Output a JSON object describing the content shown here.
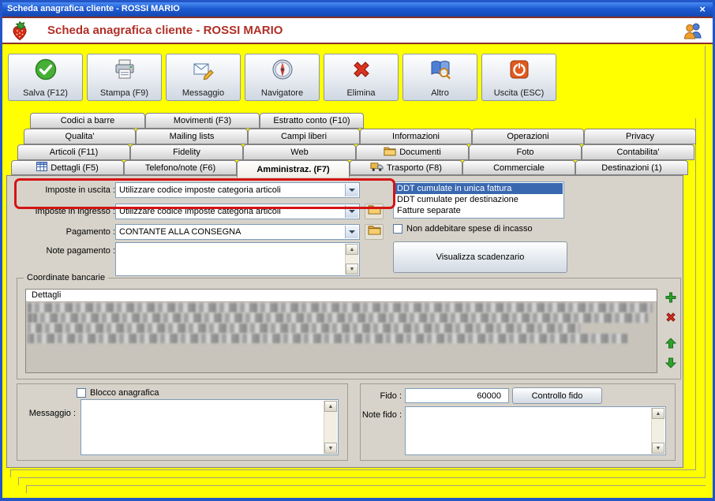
{
  "window": {
    "title": "Scheda anagrafica cliente - ROSSI MARIO",
    "close_glyph": "×"
  },
  "header": {
    "title": "Scheda anagrafica cliente - ROSSI MARIO"
  },
  "toolbar": {
    "buttons": [
      {
        "label": "Salva (F12)",
        "icon": "save-check-icon"
      },
      {
        "label": "Stampa (F9)",
        "icon": "printer-icon"
      },
      {
        "label": "Messaggio",
        "icon": "message-icon"
      },
      {
        "label": "Navigatore",
        "icon": "compass-icon"
      },
      {
        "label": "Elimina",
        "icon": "delete-x-icon"
      },
      {
        "label": "Altro",
        "icon": "book-search-icon"
      },
      {
        "label": "Uscita (ESC)",
        "icon": "power-icon"
      }
    ]
  },
  "tabs": {
    "rows": [
      [
        {
          "label": "Codici a barre"
        },
        {
          "label": "Movimenti (F3)"
        },
        {
          "label": "Estratto conto (F10)"
        }
      ],
      [
        {
          "label": "Qualita'"
        },
        {
          "label": "Mailing lists"
        },
        {
          "label": "Campi liberi"
        },
        {
          "label": "Informazioni"
        },
        {
          "label": "Operazioni"
        },
        {
          "label": "Privacy"
        }
      ],
      [
        {
          "label": "Articoli (F11)"
        },
        {
          "label": "Fidelity"
        },
        {
          "label": "Web"
        },
        {
          "label": "Documenti",
          "icon": "folder"
        },
        {
          "label": "Foto"
        },
        {
          "label": "Contabilita'"
        }
      ],
      [
        {
          "label": "Dettagli (F5)",
          "icon": "grid"
        },
        {
          "label": "Telefono/note (F6)"
        },
        {
          "label": "Amministraz. (F7)",
          "active": true
        },
        {
          "label": "Trasporto (F8)",
          "icon": "truck"
        },
        {
          "label": "Commerciale"
        },
        {
          "label": "Destinazioni (1)"
        }
      ]
    ]
  },
  "form": {
    "imposte_uscita": {
      "label": "Imposte in uscita :",
      "value": "Utilizzare codice imposte categoria articoli"
    },
    "imposte_ingresso": {
      "label": "Imposte in ingresso :",
      "value": "Utilizzare codice imposte categoria articoli"
    },
    "pagamento": {
      "label": "Pagamento :",
      "value": "CONTANTE ALLA CONSEGNA"
    },
    "note_pagamento_label": "Note pagamento :",
    "fatturazione_options": [
      "DDT cumulate in unica fattura",
      "DDT cumulate per destinazione",
      "Fatture separate"
    ],
    "spese_incasso_checkbox": "Non addebitare spese di incasso",
    "visualizza_scadenzario_button": "Visualizza scadenzario"
  },
  "coordinate_bancarie": {
    "group_title": "Coordinate bancarie",
    "table_header": "Dettagli"
  },
  "blocco": {
    "checkbox_label": "Blocco anagrafica",
    "messaggio_label": "Messaggio :"
  },
  "fido": {
    "label": "Fido :",
    "value": "60000",
    "controllo_button": "Controllo fido",
    "note_label": "Note fido :"
  }
}
